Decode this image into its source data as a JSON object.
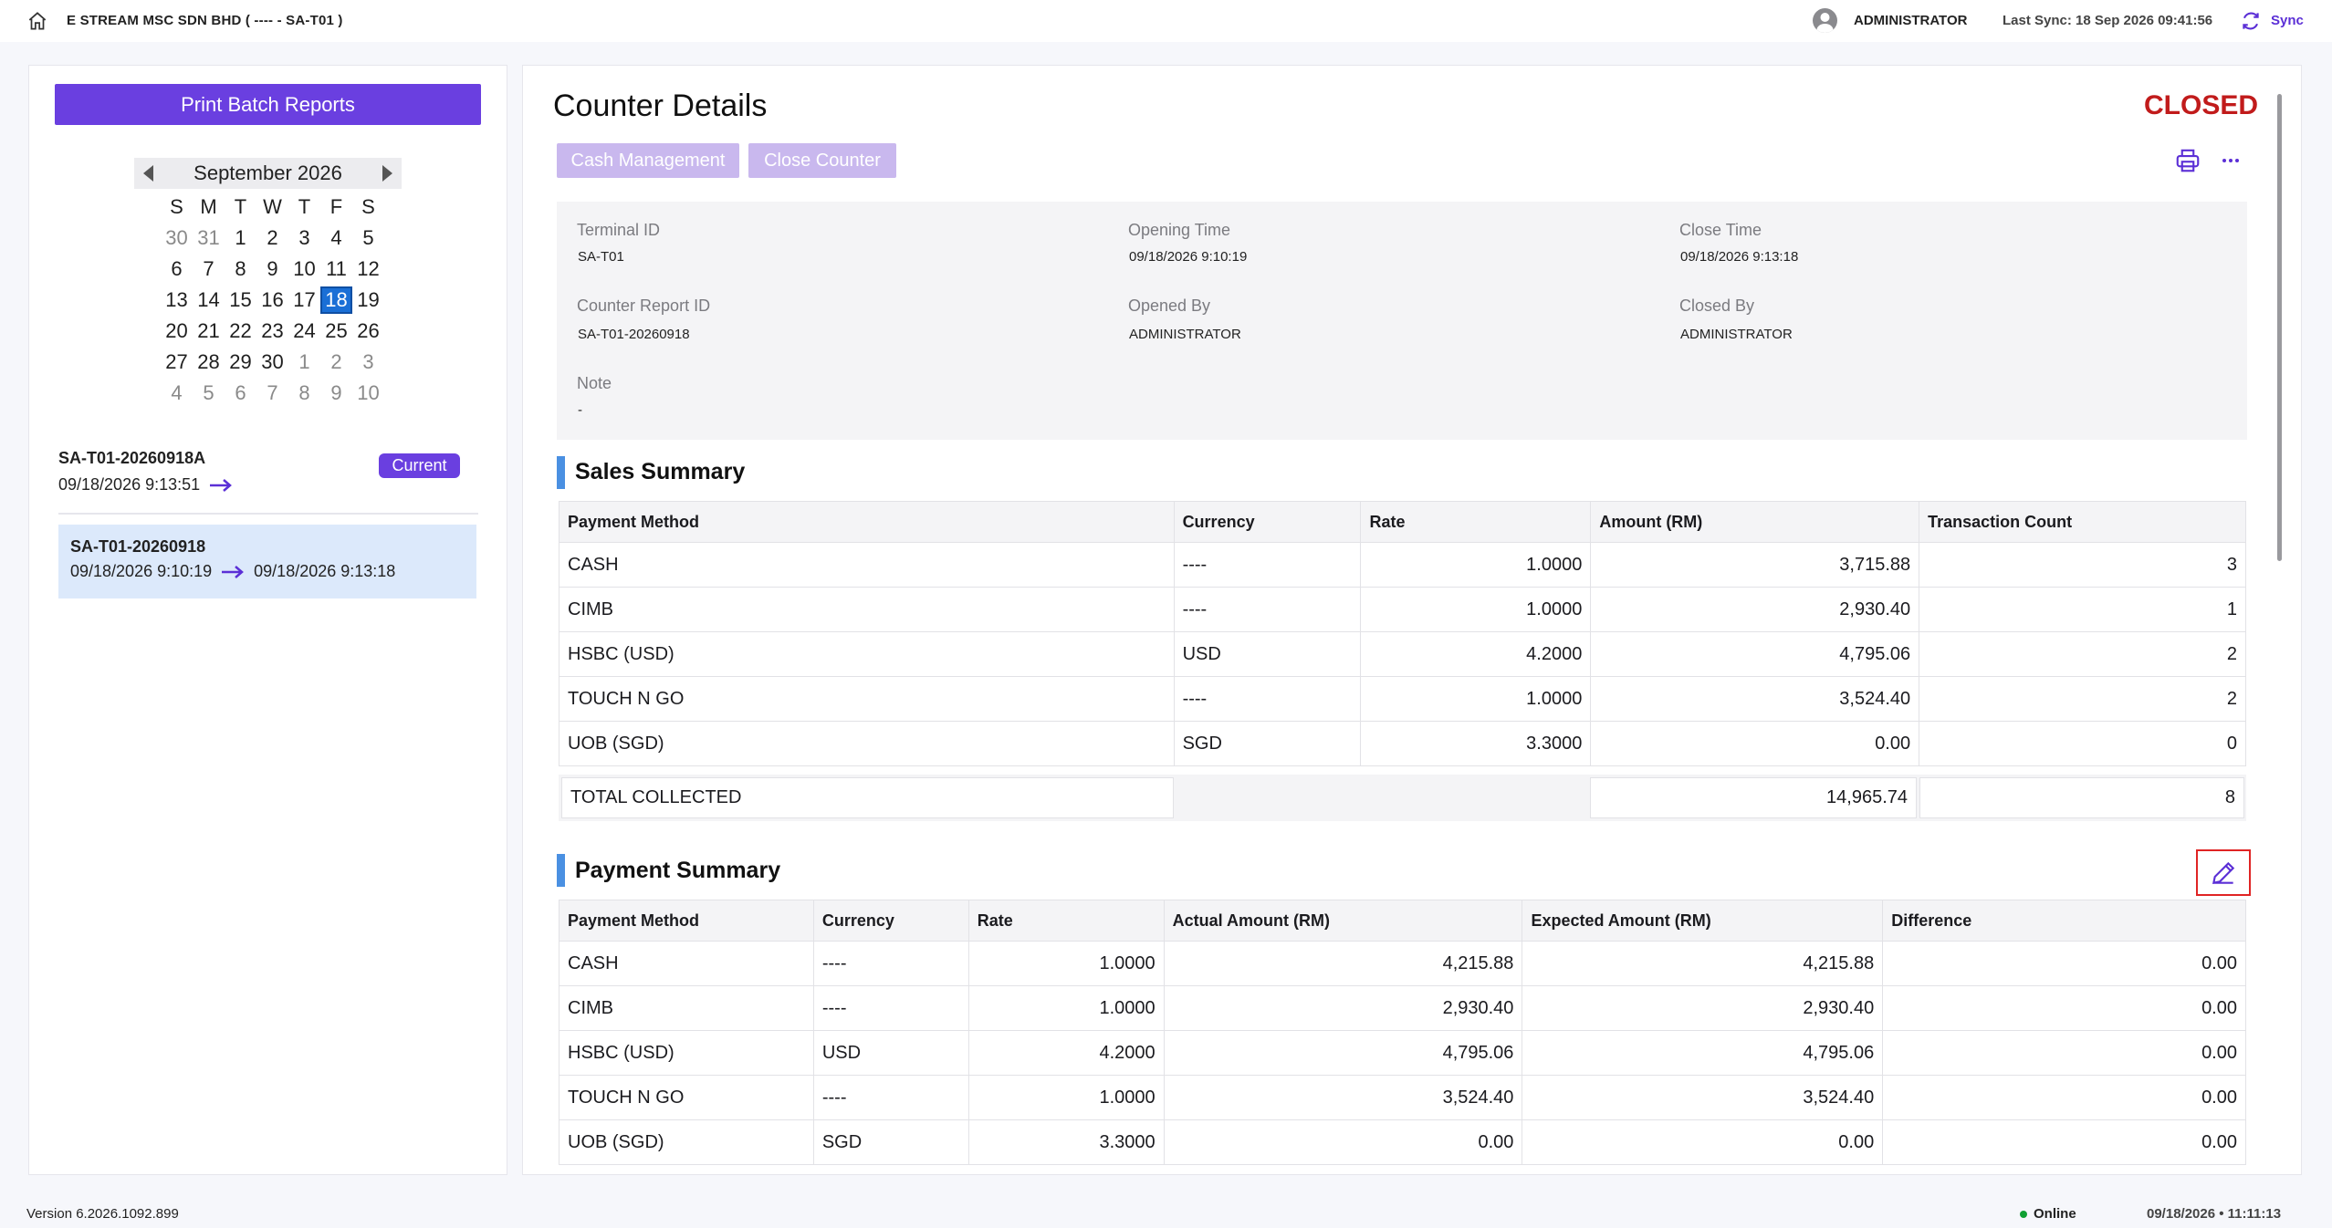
{
  "header": {
    "store_title": "E STREAM MSC SDN BHD ( ---- - SA-T01 )",
    "user_name": "ADMINISTRATOR",
    "last_sync": "Last Sync: 18 Sep 2026 09:41:56",
    "sync_label": "Sync"
  },
  "sidebar": {
    "print_batch_label": "Print Batch Reports",
    "calendar": {
      "month_title": "September 2026",
      "weekdays": [
        "S",
        "M",
        "T",
        "W",
        "T",
        "F",
        "S"
      ],
      "weeks": [
        [
          "30",
          "31",
          "1",
          "2",
          "3",
          "4",
          "5"
        ],
        [
          "6",
          "7",
          "8",
          "9",
          "10",
          "11",
          "12"
        ],
        [
          "13",
          "14",
          "15",
          "16",
          "17",
          "18",
          "19"
        ],
        [
          "20",
          "21",
          "22",
          "23",
          "24",
          "25",
          "26"
        ],
        [
          "27",
          "28",
          "29",
          "30",
          "1",
          "2",
          "3"
        ],
        [
          "4",
          "5",
          "6",
          "7",
          "8",
          "9",
          "10"
        ]
      ],
      "selected": "18"
    },
    "reports": [
      {
        "id": "SA-T01-20260918A",
        "start": "09/18/2026 9:13:51",
        "end": "",
        "badge": "Current"
      },
      {
        "id": "SA-T01-20260918",
        "start": "09/18/2026 9:10:19",
        "end": "09/18/2026 9:13:18",
        "badge": ""
      }
    ]
  },
  "main": {
    "title": "Counter Details",
    "status": "CLOSED",
    "status_color": "#c11b1b",
    "buttons": {
      "cash_management": "Cash Management",
      "close_counter": "Close Counter"
    },
    "details": {
      "terminal_id_label": "Terminal ID",
      "terminal_id": "SA-T01",
      "opening_time_label": "Opening Time",
      "opening_time": "09/18/2026 9:10:19",
      "close_time_label": "Close Time",
      "close_time": "09/18/2026 9:13:18",
      "report_id_label": "Counter Report ID",
      "report_id": "SA-T01-20260918",
      "opened_by_label": "Opened By",
      "opened_by": "ADMINISTRATOR",
      "closed_by_label": "Closed By",
      "closed_by": "ADMINISTRATOR",
      "note_label": "Note",
      "note": "-"
    },
    "sales_summary": {
      "title": "Sales Summary",
      "columns": [
        "Payment Method",
        "Currency",
        "Rate",
        "Amount (RM)",
        "Transaction Count"
      ],
      "rows": [
        [
          "CASH",
          "----",
          "1.0000",
          "3,715.88",
          "3"
        ],
        [
          "CIMB",
          "----",
          "1.0000",
          "2,930.40",
          "1"
        ],
        [
          "HSBC (USD)",
          "USD",
          "4.2000",
          "4,795.06",
          "2"
        ],
        [
          "TOUCH N GO",
          "----",
          "1.0000",
          "3,524.40",
          "2"
        ],
        [
          "UOB (SGD)",
          "SGD",
          "3.3000",
          "0.00",
          "0"
        ]
      ],
      "total_label": "TOTAL COLLECTED",
      "total_amount": "14,965.74",
      "total_count": "8"
    },
    "payment_summary": {
      "title": "Payment Summary",
      "columns": [
        "Payment Method",
        "Currency",
        "Rate",
        "Actual Amount (RM)",
        "Expected Amount (RM)",
        "Difference"
      ],
      "rows": [
        [
          "CASH",
          "----",
          "1.0000",
          "4,215.88",
          "4,215.88",
          "0.00"
        ],
        [
          "CIMB",
          "----",
          "1.0000",
          "2,930.40",
          "2,930.40",
          "0.00"
        ],
        [
          "HSBC (USD)",
          "USD",
          "4.2000",
          "4,795.06",
          "4,795.06",
          "0.00"
        ],
        [
          "TOUCH N GO",
          "----",
          "1.0000",
          "3,524.40",
          "3,524.40",
          "0.00"
        ],
        [
          "UOB (SGD)",
          "SGD",
          "3.3000",
          "0.00",
          "0.00",
          "0.00"
        ]
      ]
    }
  },
  "footer": {
    "version": "Version 6.2026.1092.899",
    "online_label": "Online",
    "datetime": "09/18/2026 • 11:11:13"
  },
  "colors": {
    "accent": "#6a3fe0",
    "selected_date": "#1a6fd6",
    "section_bar": "#4a90e2",
    "online": "#10a033",
    "edit_highlight": "#e02424"
  }
}
